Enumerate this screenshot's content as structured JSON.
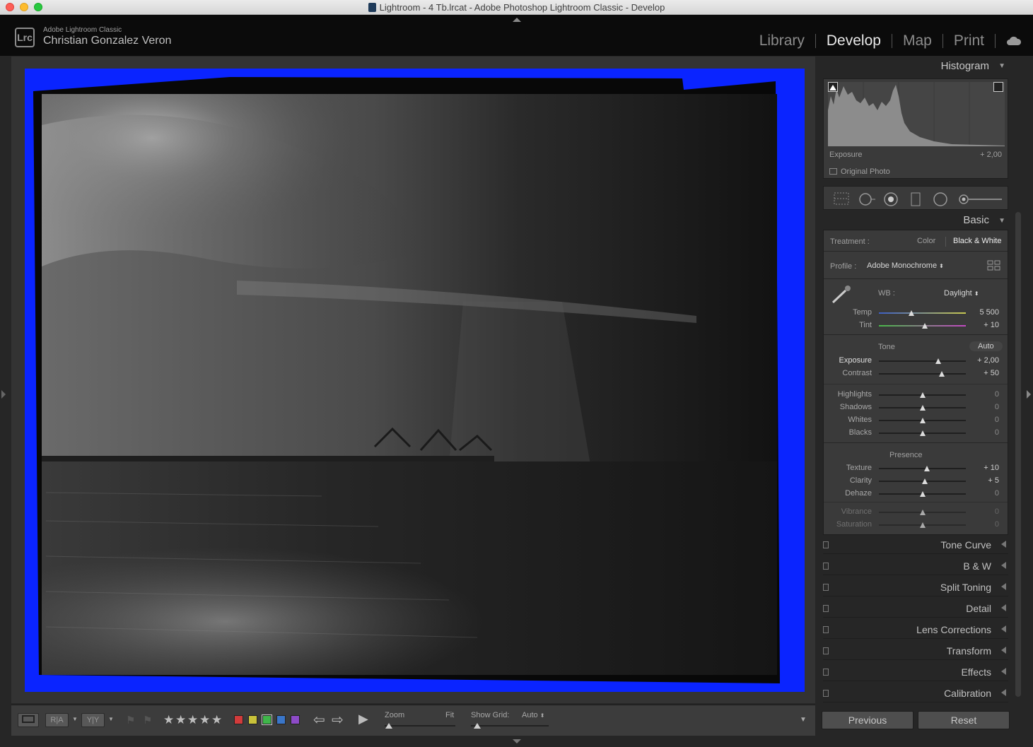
{
  "window": {
    "title": "Lightroom - 4 Tb.lrcat - Adobe Photoshop Lightroom Classic - Develop"
  },
  "identity": {
    "logo": "Lrc",
    "app_name": "Adobe Lightroom Classic",
    "user": "Christian Gonzalez Veron"
  },
  "modules": [
    {
      "label": "Library",
      "active": false
    },
    {
      "label": "Develop",
      "active": true
    },
    {
      "label": "Map",
      "active": false
    },
    {
      "label": "Print",
      "active": false
    }
  ],
  "histogram": {
    "title": "Histogram",
    "label": "Exposure",
    "value": "+ 2,00",
    "original_photo": "Original Photo"
  },
  "basic": {
    "title": "Basic",
    "treatment_label": "Treatment :",
    "treatment_color": "Color",
    "treatment_bw": "Black & White",
    "profile_label": "Profile :",
    "profile_value": "Adobe Monochrome",
    "wb_label": "WB :",
    "wb_value": "Daylight",
    "tone_label": "Tone",
    "auto_label": "Auto",
    "presence_label": "Presence",
    "sliders": {
      "temp": {
        "label": "Temp",
        "value": "5 500",
        "pos": 0.37
      },
      "tint": {
        "label": "Tint",
        "value": "+ 10",
        "pos": 0.53
      },
      "exposure": {
        "label": "Exposure",
        "value": "+ 2,00",
        "pos": 0.68
      },
      "contrast": {
        "label": "Contrast",
        "value": "+ 50",
        "pos": 0.72
      },
      "highlights": {
        "label": "Highlights",
        "value": "0",
        "pos": 0.5
      },
      "shadows": {
        "label": "Shadows",
        "value": "0",
        "pos": 0.5
      },
      "whites": {
        "label": "Whites",
        "value": "0",
        "pos": 0.5
      },
      "blacks": {
        "label": "Blacks",
        "value": "0",
        "pos": 0.5
      },
      "texture": {
        "label": "Texture",
        "value": "+ 10",
        "pos": 0.55
      },
      "clarity": {
        "label": "Clarity",
        "value": "+ 5",
        "pos": 0.525
      },
      "dehaze": {
        "label": "Dehaze",
        "value": "0",
        "pos": 0.5
      },
      "vibrance": {
        "label": "Vibrance",
        "value": "0",
        "pos": 0.5
      },
      "saturation": {
        "label": "Saturation",
        "value": "0",
        "pos": 0.5
      }
    }
  },
  "collapsed_panels": [
    "Tone Curve",
    "B & W",
    "Split Toning",
    "Detail",
    "Lens Corrections",
    "Transform",
    "Effects",
    "Calibration"
  ],
  "footer_buttons": {
    "previous": "Previous",
    "reset": "Reset"
  },
  "toolbar": {
    "zoom_label": "Zoom",
    "zoom_value": "Fit",
    "grid_label": "Show Grid:",
    "grid_value": "Auto",
    "ra": "R|A",
    "yy": "Y|Y",
    "stars": [
      "★",
      "★",
      "★",
      "★",
      "★"
    ],
    "colors": [
      "#d23b3b",
      "#c9c23a",
      "#3fb64a",
      "#3a76c9",
      "#8d4bc7"
    ]
  },
  "colors": {
    "frame": "#0a24ff",
    "accent_text": "#e8e8e8"
  }
}
